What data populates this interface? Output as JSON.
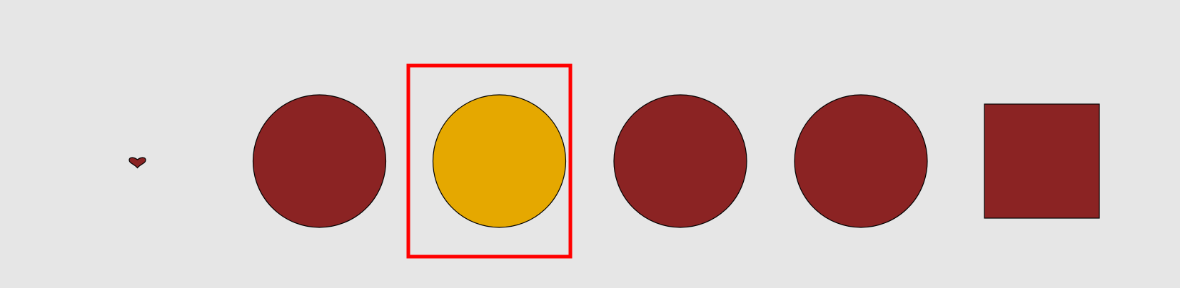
{
  "colors": {
    "background": "#e6e6e6",
    "shape_fill": "#8b2323",
    "highlight_fill": "#e5a800",
    "outline": "#000000",
    "selection_frame": "#ff0000"
  },
  "shapes": [
    {
      "name": "small-heart-icon",
      "kind": "heart",
      "fill": "shape_fill",
      "selected": false
    },
    {
      "name": "circle-1",
      "kind": "circle",
      "fill": "shape_fill",
      "selected": false
    },
    {
      "name": "circle-2",
      "kind": "circle",
      "fill": "highlight_fill",
      "selected": true
    },
    {
      "name": "circle-3",
      "kind": "circle",
      "fill": "shape_fill",
      "selected": false
    },
    {
      "name": "circle-4",
      "kind": "circle",
      "fill": "shape_fill",
      "selected": false
    },
    {
      "name": "square-1",
      "kind": "square",
      "fill": "shape_fill",
      "selected": false
    }
  ]
}
